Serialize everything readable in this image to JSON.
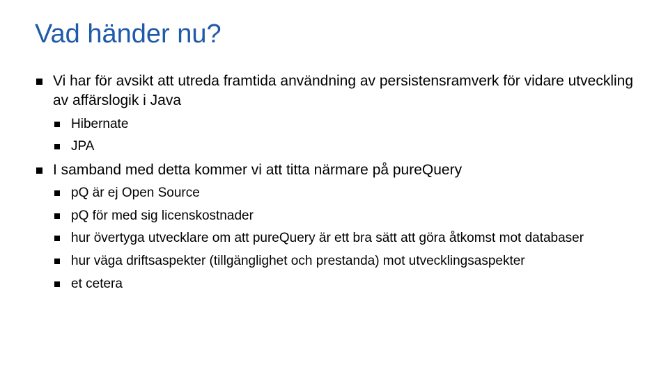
{
  "title": "Vad händer nu?",
  "bullets": {
    "b1": "Vi har för avsikt att utreda framtida användning av persistensramverk för vidare utveckling av affärslogik i Java",
    "b1_1": "Hibernate",
    "b1_2": "JPA",
    "b2": "I samband med detta kommer vi att titta närmare på pureQuery",
    "b2_1": "pQ är ej Open Source",
    "b2_2": "pQ för med sig licenskostnader",
    "b2_3": "hur övertyga utvecklare om att pureQuery är ett bra sätt att göra åtkomst mot databaser",
    "b2_4": "hur väga driftsaspekter (tillgänglighet och prestanda) mot utvecklingsaspekter",
    "b2_5": "et cetera"
  }
}
